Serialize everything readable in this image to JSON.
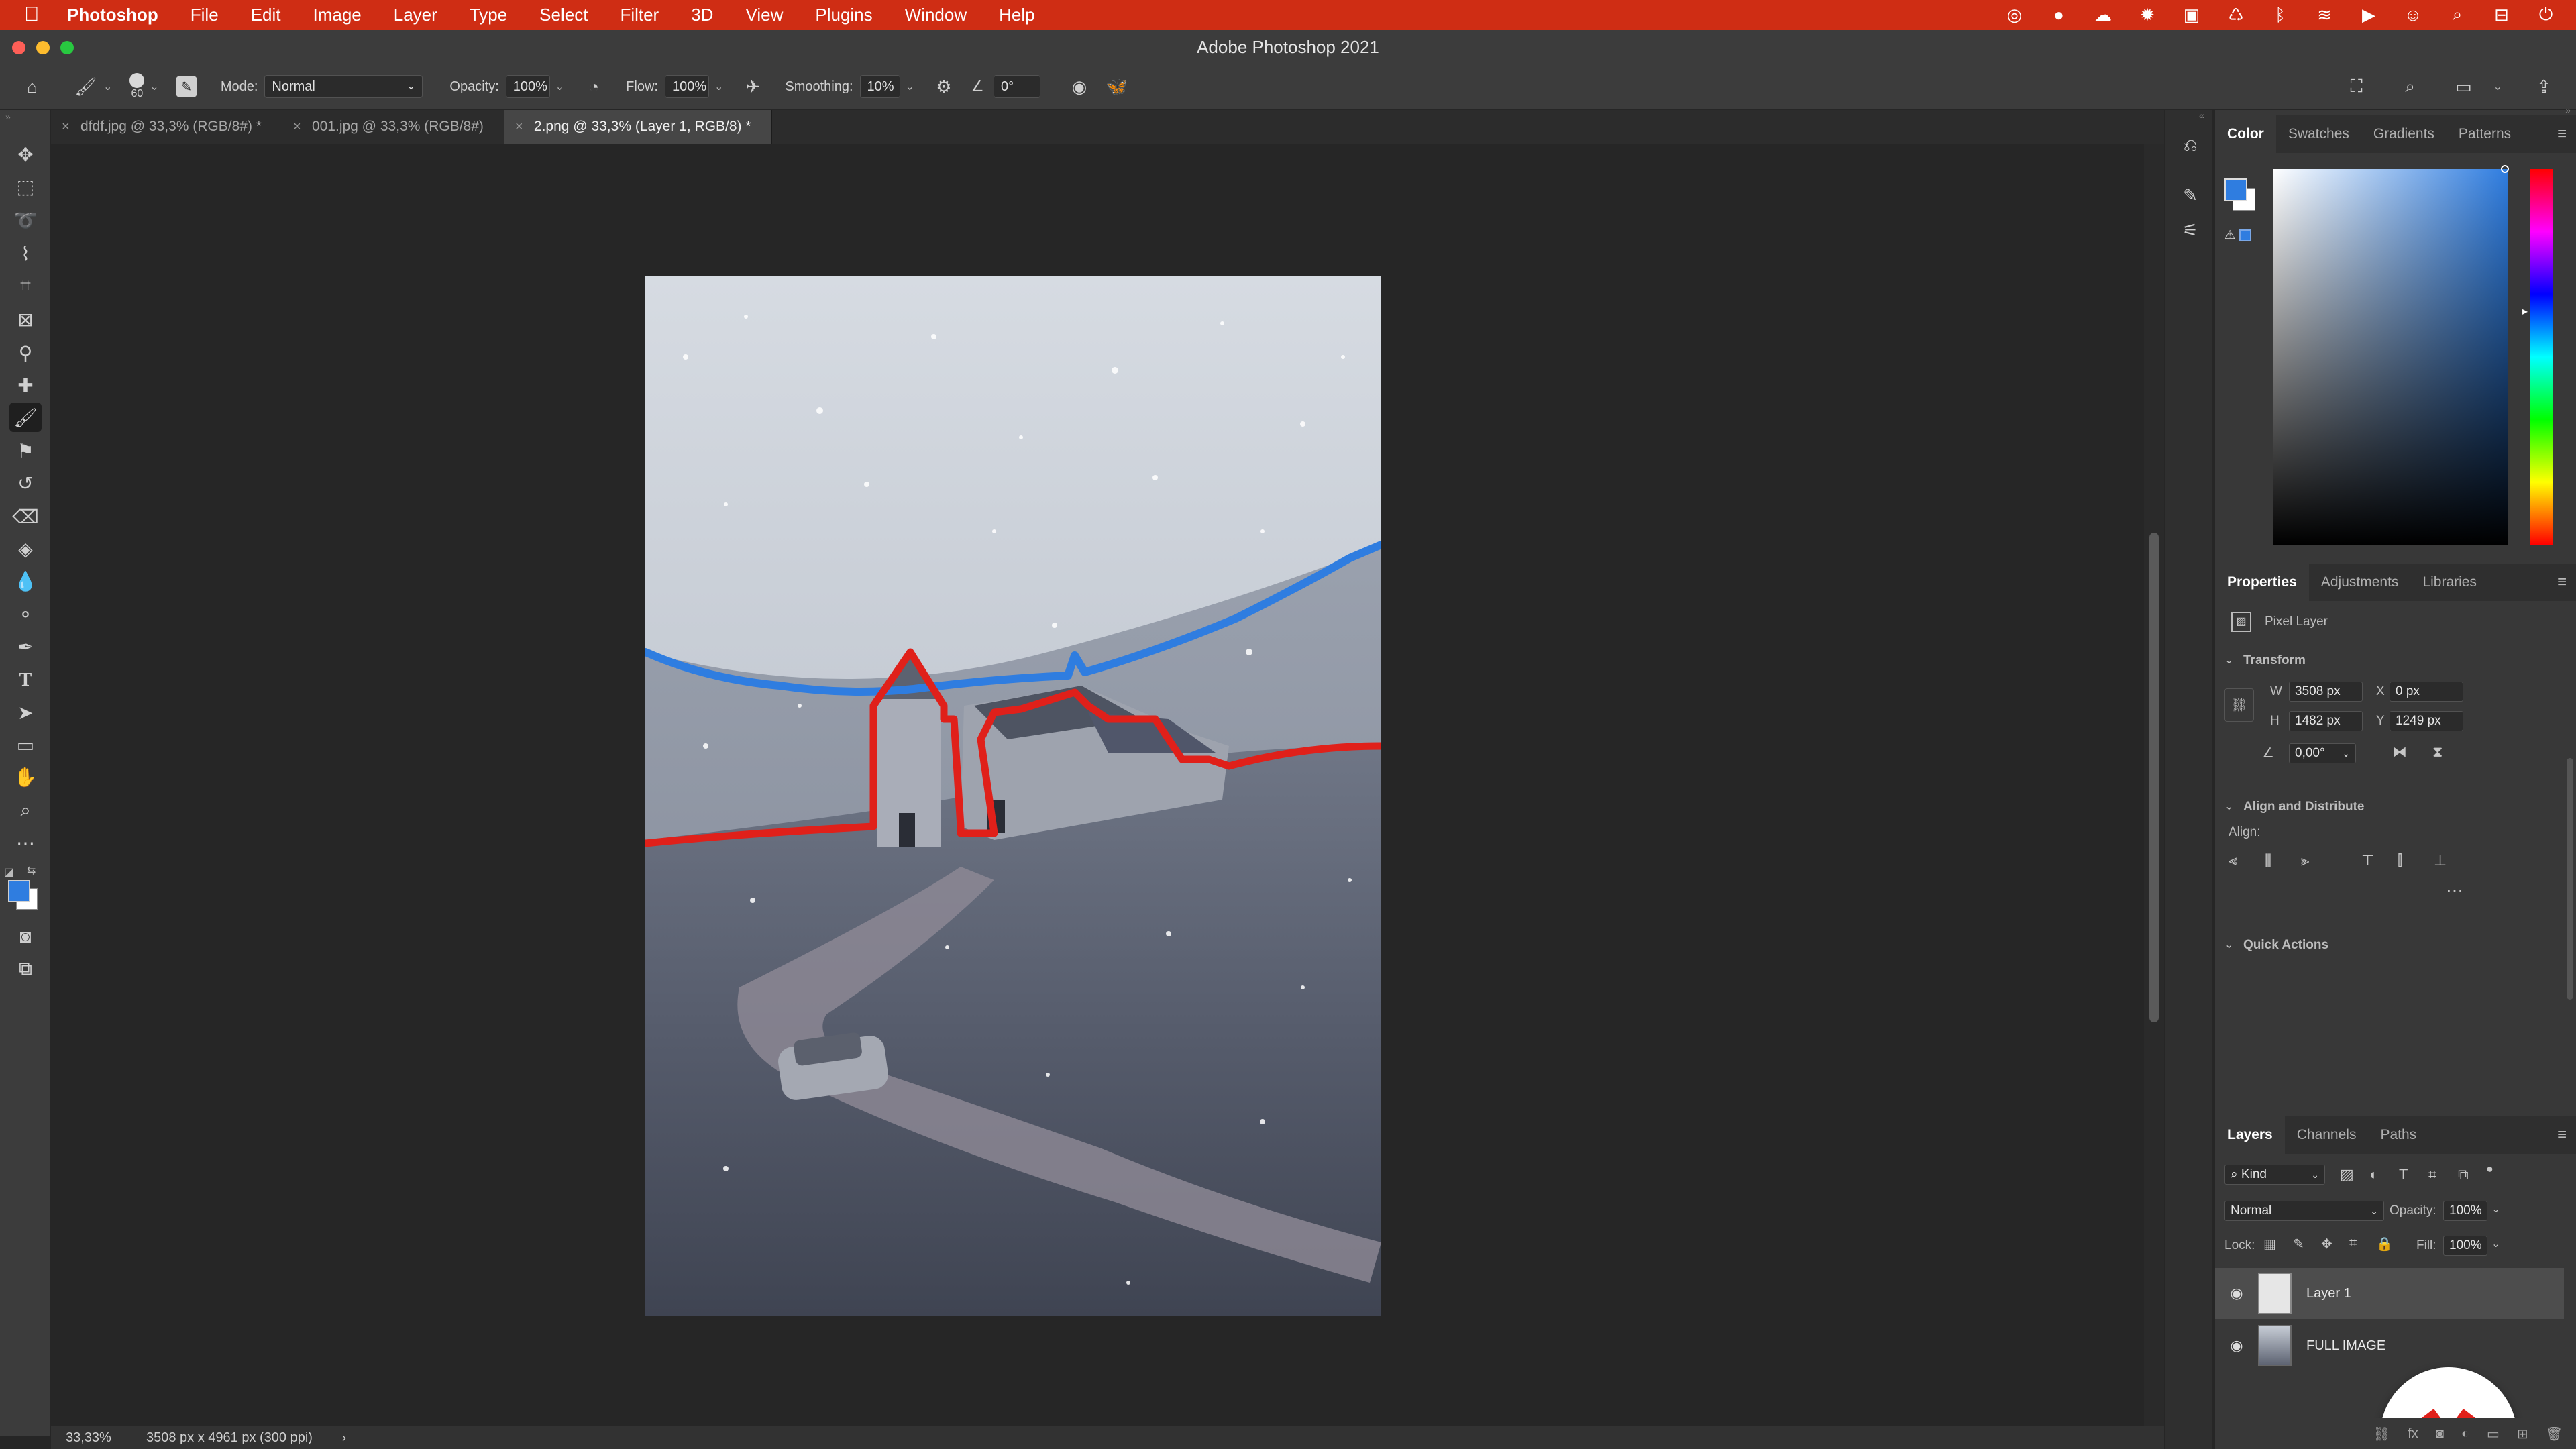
{
  "menubar": {
    "app_name": "Photoshop",
    "items": [
      "File",
      "Edit",
      "Image",
      "Layer",
      "Type",
      "Select",
      "Filter",
      "3D",
      "View",
      "Plugins",
      "Window",
      "Help"
    ]
  },
  "window": {
    "title": "Adobe Photoshop 2021"
  },
  "options": {
    "brush_size": "60",
    "mode_label": "Mode:",
    "mode_value": "Normal",
    "opacity_label": "Opacity:",
    "opacity_value": "100%",
    "flow_label": "Flow:",
    "flow_value": "100%",
    "smoothing_label": "Smoothing:",
    "smoothing_value": "10%",
    "angle_value": "0°"
  },
  "tabs": [
    {
      "label": "dfdf.jpg @ 33,3% (RGB/8#) *"
    },
    {
      "label": "001.jpg @ 33,3% (RGB/8#)"
    },
    {
      "label": "2.png @ 33,3% (Layer 1, RGB/8) *"
    }
  ],
  "status": {
    "zoom": "33,33%",
    "doc_info": "3508 px x 4961 px (300 ppi)"
  },
  "color_panel": {
    "tabs": [
      "Color",
      "Swatches",
      "Gradients",
      "Patterns"
    ],
    "foreground": "#2f7de0",
    "background": "#ffffff"
  },
  "properties": {
    "tabs": [
      "Properties",
      "Adjustments",
      "Libraries"
    ],
    "layer_kind": "Pixel Layer",
    "transform_title": "Transform",
    "w_label": "W",
    "w_value": "3508 px",
    "x_label": "X",
    "x_value": "0 px",
    "h_label": "H",
    "h_value": "1482 px",
    "y_label": "Y",
    "y_value": "1249 px",
    "angle_value": "0,00°",
    "align_title": "Align and Distribute",
    "align_label": "Align:",
    "quick_actions_title": "Quick Actions"
  },
  "layers_panel": {
    "tabs": [
      "Layers",
      "Channels",
      "Paths"
    ],
    "filter_kind": "Kind",
    "blend_mode": "Normal",
    "opacity_label": "Opacity:",
    "opacity_value": "100%",
    "lock_label": "Lock:",
    "fill_label": "Fill:",
    "fill_value": "100%",
    "layers": [
      {
        "name": "Layer 1",
        "selected": true
      },
      {
        "name": "FULL IMAGE",
        "selected": false
      }
    ]
  },
  "icons": {
    "brand_badge": "red-heart-logo",
    "accent": "#cf2d14"
  }
}
